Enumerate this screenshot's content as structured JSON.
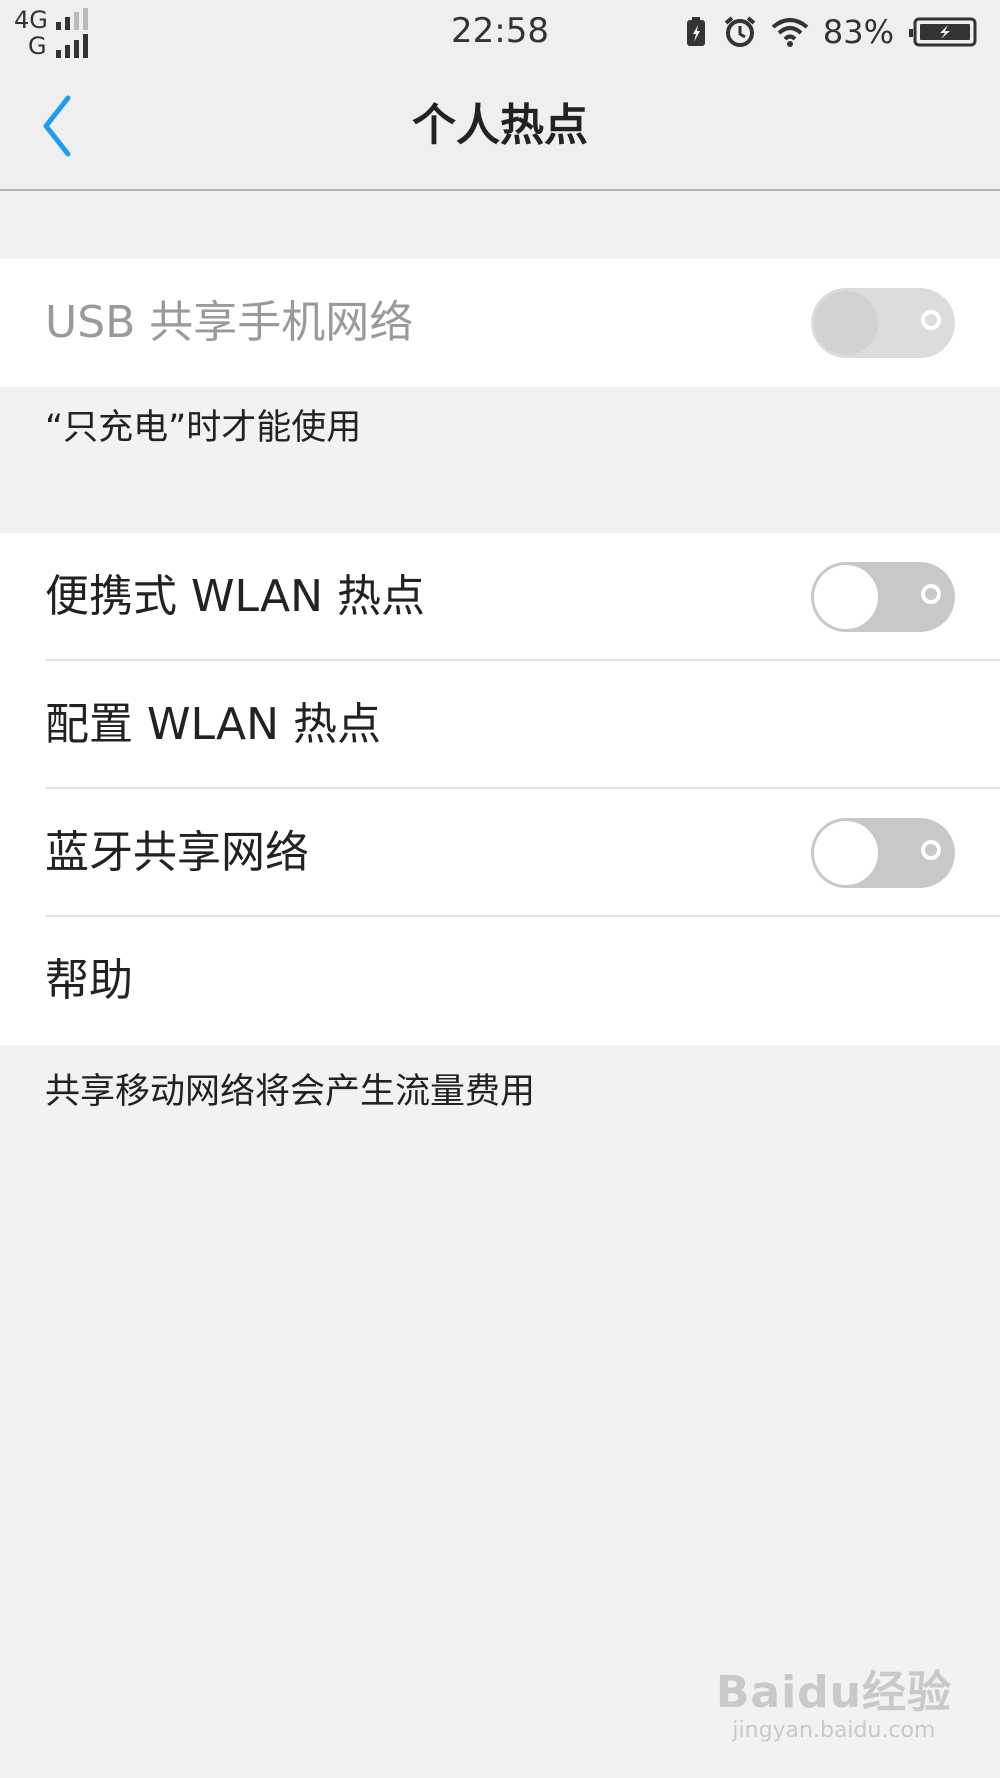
{
  "status_bar": {
    "network_top": "4G",
    "network_bottom": "G",
    "time": "22:58",
    "battery_percent": "83%",
    "icons": [
      "signal-icon",
      "battery-saver-icon",
      "alarm-icon",
      "wifi-icon",
      "battery-charging-icon"
    ]
  },
  "header": {
    "title": "个人热点",
    "back_icon": "chevron-left-icon",
    "accent_color": "#1a9df2"
  },
  "usb_section": {
    "label": "USB 共享手机网络",
    "enabled": false,
    "toggle_on": false,
    "note": "“只充电”时才能使用"
  },
  "main_section": {
    "items": [
      {
        "label": "便携式 WLAN 热点",
        "has_toggle": true,
        "toggle_on": false
      },
      {
        "label": "配置 WLAN 热点",
        "has_toggle": false
      },
      {
        "label": "蓝牙共享网络",
        "has_toggle": true,
        "toggle_on": false
      },
      {
        "label": "帮助",
        "has_toggle": false
      }
    ],
    "note": "共享移动网络将会产生流量费用"
  },
  "watermark": {
    "brand": "Baidu经验",
    "url": "jingyan.baidu.com"
  }
}
